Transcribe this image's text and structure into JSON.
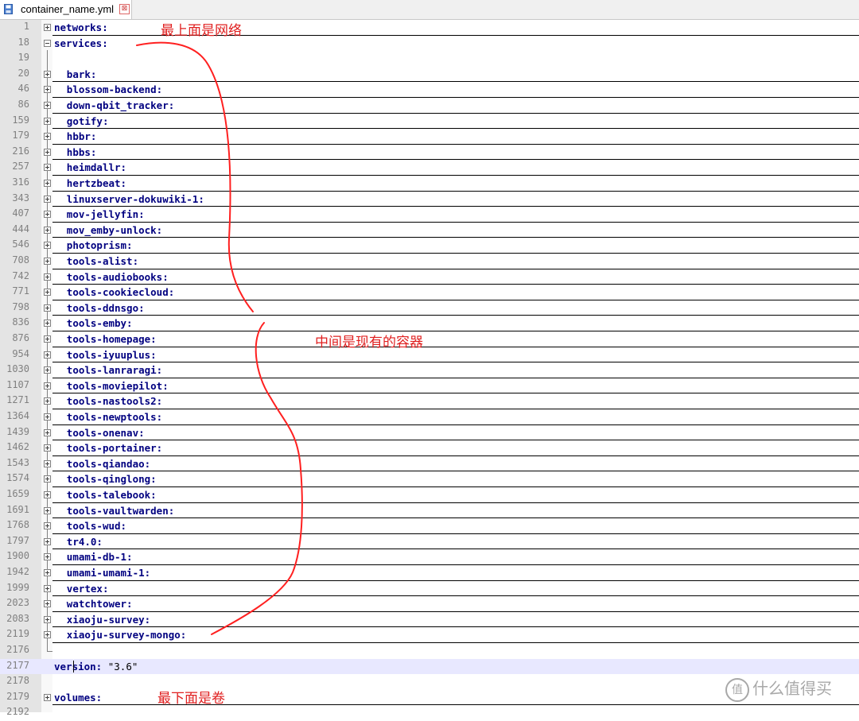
{
  "tab": {
    "filename": "container_name.yml",
    "close_symbol": "⊠"
  },
  "annotations": {
    "top": "最上面是网络",
    "middle": "中间是现有的容器",
    "bottom": "最下面是卷",
    "color": "#e02020"
  },
  "watermark": {
    "icon": "值",
    "text": "什么值得买"
  },
  "lines": [
    {
      "num": "1",
      "text": "networks:",
      "indent": 0,
      "fold": "plus",
      "underline": true
    },
    {
      "num": "18",
      "text": "services:",
      "indent": 0,
      "fold": "minus",
      "underline": false
    },
    {
      "num": "19",
      "text": "",
      "indent": 0,
      "fold": "none",
      "underline": false
    },
    {
      "num": "20",
      "text": "bark:",
      "indent": 2,
      "fold": "plus",
      "underline": true
    },
    {
      "num": "46",
      "text": "blossom-backend:",
      "indent": 2,
      "fold": "plus",
      "underline": true
    },
    {
      "num": "86",
      "text": "down-qbit_tracker:",
      "indent": 2,
      "fold": "plus",
      "underline": true
    },
    {
      "num": "159",
      "text": "gotify:",
      "indent": 2,
      "fold": "plus",
      "underline": true
    },
    {
      "num": "179",
      "text": "hbbr:",
      "indent": 2,
      "fold": "plus",
      "underline": true
    },
    {
      "num": "216",
      "text": "hbbs:",
      "indent": 2,
      "fold": "plus",
      "underline": true
    },
    {
      "num": "257",
      "text": "heimdallr:",
      "indent": 2,
      "fold": "plus",
      "underline": true
    },
    {
      "num": "316",
      "text": "hertzbeat:",
      "indent": 2,
      "fold": "plus",
      "underline": true
    },
    {
      "num": "343",
      "text": "linuxserver-dokuwiki-1:",
      "indent": 2,
      "fold": "plus",
      "underline": true
    },
    {
      "num": "407",
      "text": "mov-jellyfin:",
      "indent": 2,
      "fold": "plus",
      "underline": true
    },
    {
      "num": "444",
      "text": "mov_emby-unlock:",
      "indent": 2,
      "fold": "plus",
      "underline": true
    },
    {
      "num": "546",
      "text": "photoprism:",
      "indent": 2,
      "fold": "plus",
      "underline": true
    },
    {
      "num": "708",
      "text": "tools-alist:",
      "indent": 2,
      "fold": "plus",
      "underline": true
    },
    {
      "num": "742",
      "text": "tools-audiobooks:",
      "indent": 2,
      "fold": "plus",
      "underline": true
    },
    {
      "num": "771",
      "text": "tools-cookiecloud:",
      "indent": 2,
      "fold": "plus",
      "underline": true
    },
    {
      "num": "798",
      "text": "tools-ddnsgo:",
      "indent": 2,
      "fold": "plus",
      "underline": true
    },
    {
      "num": "836",
      "text": "tools-emby:",
      "indent": 2,
      "fold": "plus",
      "underline": true
    },
    {
      "num": "876",
      "text": "tools-homepage:",
      "indent": 2,
      "fold": "plus",
      "underline": true
    },
    {
      "num": "954",
      "text": "tools-iyuuplus:",
      "indent": 2,
      "fold": "plus",
      "underline": true
    },
    {
      "num": "1030",
      "text": "tools-lanraragi:",
      "indent": 2,
      "fold": "plus",
      "underline": true
    },
    {
      "num": "1107",
      "text": "tools-moviepilot:",
      "indent": 2,
      "fold": "plus",
      "underline": true
    },
    {
      "num": "1271",
      "text": "tools-nastools2:",
      "indent": 2,
      "fold": "plus",
      "underline": true
    },
    {
      "num": "1364",
      "text": "tools-newptools:",
      "indent": 2,
      "fold": "plus",
      "underline": true
    },
    {
      "num": "1439",
      "text": "tools-onenav:",
      "indent": 2,
      "fold": "plus",
      "underline": true
    },
    {
      "num": "1462",
      "text": "tools-portainer:",
      "indent": 2,
      "fold": "plus",
      "underline": true
    },
    {
      "num": "1543",
      "text": "tools-qiandao:",
      "indent": 2,
      "fold": "plus",
      "underline": true
    },
    {
      "num": "1574",
      "text": "tools-qinglong:",
      "indent": 2,
      "fold": "plus",
      "underline": true
    },
    {
      "num": "1659",
      "text": "tools-talebook:",
      "indent": 2,
      "fold": "plus",
      "underline": true
    },
    {
      "num": "1691",
      "text": "tools-vaultwarden:",
      "indent": 2,
      "fold": "plus",
      "underline": true
    },
    {
      "num": "1768",
      "text": "tools-wud:",
      "indent": 2,
      "fold": "plus",
      "underline": true
    },
    {
      "num": "1797",
      "text": "tr4.0:",
      "indent": 2,
      "fold": "plus",
      "underline": true
    },
    {
      "num": "1900",
      "text": "umami-db-1:",
      "indent": 2,
      "fold": "plus",
      "underline": true
    },
    {
      "num": "1942",
      "text": "umami-umami-1:",
      "indent": 2,
      "fold": "plus",
      "underline": true
    },
    {
      "num": "1999",
      "text": "vertex:",
      "indent": 2,
      "fold": "plus",
      "underline": true
    },
    {
      "num": "2023",
      "text": "watchtower:",
      "indent": 2,
      "fold": "plus",
      "underline": true
    },
    {
      "num": "2083",
      "text": "xiaoju-survey:",
      "indent": 2,
      "fold": "plus",
      "underline": true
    },
    {
      "num": "2119",
      "text": "xiaoju-survey-mongo:",
      "indent": 2,
      "fold": "plus",
      "underline": true
    },
    {
      "num": "2176",
      "text": "",
      "indent": 0,
      "fold": "end",
      "underline": false
    },
    {
      "num": "2177",
      "text": "version:",
      "value": " \"3.6\"",
      "indent": 0,
      "fold": "none",
      "underline": false,
      "current": true
    },
    {
      "num": "2178",
      "text": "",
      "indent": 0,
      "fold": "none",
      "underline": false
    },
    {
      "num": "2179",
      "text": "volumes:",
      "indent": 0,
      "fold": "plus",
      "underline": true
    },
    {
      "num": "2192",
      "text": "",
      "indent": 0,
      "fold": "none",
      "underline": false
    }
  ]
}
